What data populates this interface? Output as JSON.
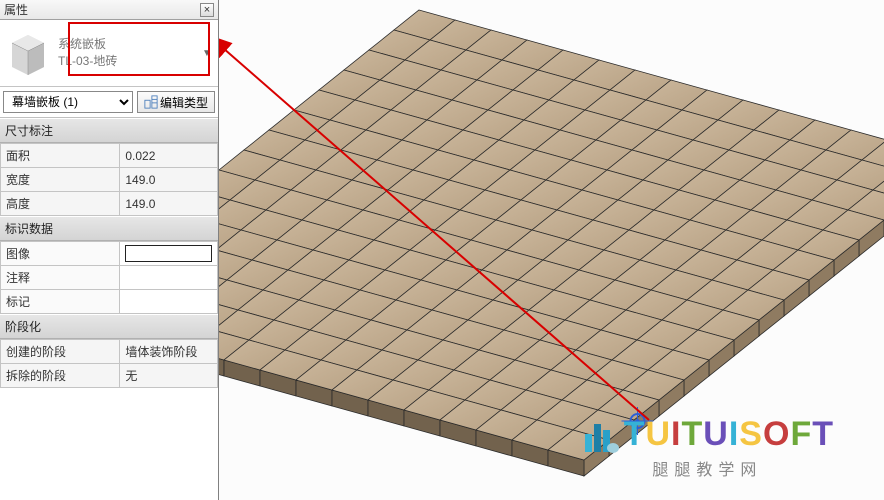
{
  "panel": {
    "title": "属性"
  },
  "type": {
    "family_label": "系统嵌板",
    "type_label": "TL-03-地砖"
  },
  "selector": {
    "label": "幕墙嵌板 (1)",
    "edit_type_label": "编辑类型"
  },
  "sections": {
    "dim_title": "尺寸标注",
    "dim": [
      {
        "label": "面积",
        "value": "0.022"
      },
      {
        "label": "宽度",
        "value": "149.0"
      },
      {
        "label": "高度",
        "value": "149.0"
      }
    ],
    "id_title": "标识数据",
    "id": [
      {
        "label": "图像",
        "value": ""
      },
      {
        "label": "注释",
        "value": ""
      },
      {
        "label": "标记",
        "value": ""
      }
    ],
    "phase_title": "阶段化",
    "phase": [
      {
        "label": "创建的阶段",
        "value": "墙体装饰阶段"
      },
      {
        "label": "拆除的阶段",
        "value": "无"
      }
    ]
  },
  "watermark": {
    "colors": [
      "#35b2d6",
      "#f5c542",
      "#c63e3e",
      "#6ea83a",
      "#6a4fb8"
    ],
    "text": "TUITUISOFT",
    "sub": "腿腿教学网"
  }
}
